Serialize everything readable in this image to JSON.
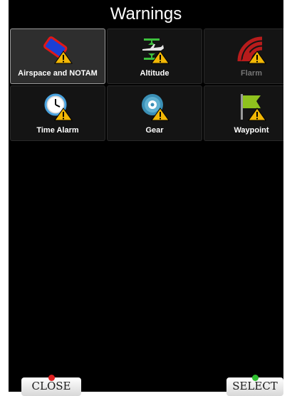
{
  "header": {
    "title": "Warnings"
  },
  "tiles": [
    {
      "label": "Airspace and NOTAM",
      "icon": "airspace-warning-icon"
    },
    {
      "label": "Altitude",
      "icon": "altitude-warning-icon"
    },
    {
      "label": "Flarm",
      "icon": "flarm-warning-icon"
    },
    {
      "label": "Time Alarm",
      "icon": "clock-warning-icon"
    },
    {
      "label": "Gear",
      "icon": "gear-warning-icon"
    },
    {
      "label": "Waypoint",
      "icon": "waypoint-flag-warning-icon"
    }
  ],
  "softkeys": {
    "close_label": "CLOSE",
    "select_label": "SELECT"
  },
  "colors": {
    "warning": "#f2b705",
    "close_mark": "#e02020",
    "select_mark": "#2fbf2f"
  }
}
